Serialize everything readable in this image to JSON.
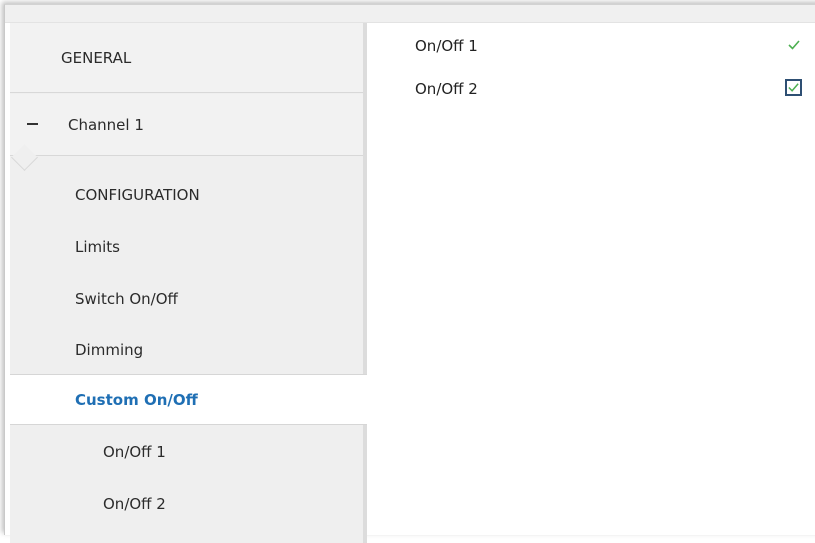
{
  "sidebar": {
    "general": "GENERAL",
    "channel": "Channel 1",
    "items": [
      {
        "label": "CONFIGURATION"
      },
      {
        "label": "Limits"
      },
      {
        "label": "Switch On/Off"
      },
      {
        "label": "Dimming"
      },
      {
        "label": "Custom On/Off"
      },
      {
        "label": "On/Off 1"
      },
      {
        "label": "On/Off 2"
      }
    ],
    "selected": "Custom On/Off"
  },
  "content": {
    "rows": [
      {
        "label": "On/Off 1",
        "checked": true
      },
      {
        "label": "On/Off 2",
        "checked": true
      }
    ]
  },
  "colors": {
    "selected_text": "#1f6fb4",
    "checkmark": "#4caf50",
    "focus_border": "#2e4f73"
  },
  "icons": {
    "collapse": "minus-icon",
    "check": "checkmark-icon"
  }
}
